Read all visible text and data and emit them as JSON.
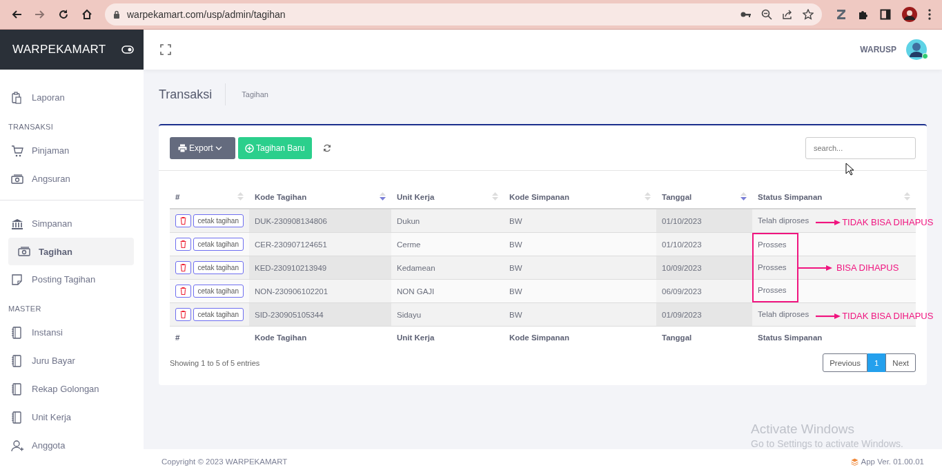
{
  "browser": {
    "nav_buttons": [
      {
        "kind": "back",
        "disabled": false
      },
      {
        "kind": "forward",
        "disabled": true
      },
      {
        "kind": "reload",
        "disabled": false
      },
      {
        "kind": "home",
        "disabled": false
      }
    ],
    "url": "warpekamart.com/usp/admin/tagihan"
  },
  "sidebar": {
    "brand": "WARPEKAMART",
    "sections": [
      {
        "items": [
          {
            "label": "Laporan",
            "selected": false
          }
        ]
      },
      {
        "heading": "TRANSAKSI",
        "items": [
          {
            "label": "Pinjaman",
            "selected": false
          },
          {
            "label": "Angsuran",
            "selected": false
          }
        ]
      },
      {
        "divider_above": true,
        "items": [
          {
            "label": "Simpanan",
            "selected": false
          },
          {
            "label": "Tagihan",
            "selected": true
          },
          {
            "label": "Posting Tagihan",
            "selected": false
          }
        ]
      },
      {
        "heading": "MASTER",
        "items": [
          {
            "label": "Instansi",
            "selected": false
          },
          {
            "label": "Juru Bayar",
            "selected": false
          },
          {
            "label": "Rekap Golongan",
            "selected": false
          },
          {
            "label": "Unit Kerja",
            "selected": false
          },
          {
            "label": "Anggota",
            "selected": false
          }
        ]
      }
    ]
  },
  "topbar": {
    "user": "WARUSP",
    "online": true
  },
  "page": {
    "title": "Transaksi",
    "breadcrumb": "Tagihan"
  },
  "toolbar": {
    "export_label": "Export",
    "new_label": "Tagihan Baru",
    "search_placeholder": "search..."
  },
  "table": {
    "columns": [
      {
        "label": "#",
        "sorted": false
      },
      {
        "label": "Kode Tagihan",
        "sorted": true
      },
      {
        "label": "Unit Kerja",
        "sorted": false
      },
      {
        "label": "Kode Simpanan",
        "sorted": false
      },
      {
        "label": "Tanggal",
        "sorted": true
      },
      {
        "label": "Status Simpanan",
        "sorted": false
      }
    ],
    "rows": [
      {
        "print_label": "cetak tagihan",
        "kode": "DUK-230908134806",
        "unit": "Dukun",
        "simpanan": "BW",
        "tanggal": "01/10/2023",
        "status": "Telah diproses",
        "note": "TIDAK BISA DIHAPUS",
        "boxed": false
      },
      {
        "print_label": "cetak tagihan",
        "kode": "CER-230907124651",
        "unit": "Cerme",
        "simpanan": "BW",
        "tanggal": "01/10/2023",
        "status": "Prosses",
        "boxed": true
      },
      {
        "print_label": "cetak tagihan",
        "kode": "KED-230910213949",
        "unit": "Kedamean",
        "simpanan": "BW",
        "tanggal": "10/09/2023",
        "status": "Prosses",
        "boxed": true
      },
      {
        "print_label": "cetak tagihan",
        "kode": "NON-230906102201",
        "unit": "NON GAJI",
        "simpanan": "BW",
        "tanggal": "06/09/2023",
        "status": "Prosses",
        "boxed": true
      },
      {
        "print_label": "cetak tagihan",
        "kode": "SID-230905105344",
        "unit": "Sidayu",
        "simpanan": "BW",
        "tanggal": "01/09/2023",
        "status": "Telah diproses",
        "note": "TIDAK BISA DIHAPUS",
        "boxed": false
      }
    ],
    "box_note": "BISA DIHAPUS",
    "footer_columns": [
      "#",
      "Kode Tagihan",
      "Unit Kerja",
      "Kode Simpanan",
      "Tanggal",
      "Status Simpanan"
    ],
    "info": "Showing 1 to 5 of 5 entries",
    "pagination": {
      "previous": "Previous",
      "pages": [
        {
          "label": "1",
          "selected": true
        }
      ],
      "next": "Next"
    }
  },
  "footer": {
    "copyright": "Copyright © 2023 WARPEKAMART",
    "version": "App Ver. 01.00.01"
  },
  "os_notice": {
    "title": "Activate Windows",
    "text": "Go to Settings to activate Windows."
  }
}
